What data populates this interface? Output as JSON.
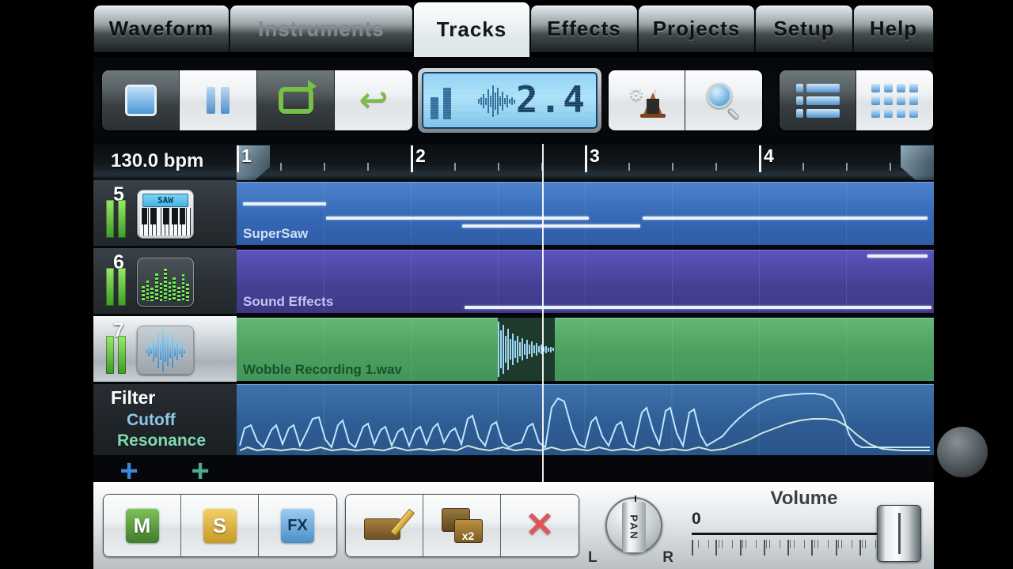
{
  "tabs": [
    {
      "label": "Waveform",
      "state": "normal"
    },
    {
      "label": "Instruments",
      "state": "dim"
    },
    {
      "label": "Tracks",
      "state": "active"
    },
    {
      "label": "Effects",
      "state": "normal"
    },
    {
      "label": "Projects",
      "state": "normal"
    },
    {
      "label": "Setup",
      "state": "normal"
    },
    {
      "label": "Help",
      "state": "normal"
    }
  ],
  "transport": {
    "stop_label": "Stop",
    "pause_label": "Pause",
    "loop_label": "Loop",
    "undo_label": "Undo",
    "undo_glyph": "↩",
    "metronome_label": "Metronome Settings",
    "gear_glyph": "⚙",
    "zoom_label": "Zoom",
    "list_view_label": "List View",
    "grid_view_label": "Grid View",
    "display_value": "2.4"
  },
  "timeline": {
    "bpm": "130.0 bpm",
    "bars": [
      "1",
      "2",
      "3",
      "4"
    ],
    "playhead_position": "2.4"
  },
  "tracks": [
    {
      "number": "5",
      "icon": "keyboard-icon",
      "icon_screen": "SAW",
      "clip_name": "SuperSaw",
      "clip_color": "#3a6fc4",
      "selected": false
    },
    {
      "number": "6",
      "icon": "equalizer-icon",
      "icon_screen": "",
      "clip_name": "Sound Effects",
      "clip_color": "#4a46a8",
      "selected": false
    },
    {
      "number": "7",
      "icon": "waveform-icon",
      "icon_screen": "",
      "clip_name": "Wobble Recording 1.wav",
      "clip_color": "#4faa63",
      "selected": true
    }
  ],
  "automation": {
    "title": "Filter",
    "param_cutoff": "Cutoff",
    "param_resonance": "Resonance",
    "cutoff_color": "#8fc7e8",
    "resonance_color": "#7fd8b0"
  },
  "add_buttons": {
    "add_midi_track": "+",
    "add_audio_track": "+"
  },
  "bottom_bar": {
    "mute_label": "M",
    "solo_label": "S",
    "fx_label": "FX",
    "edit_label": "Edit",
    "duplicate_label": "x2",
    "delete_label": "✕",
    "pan_label": "PAN",
    "pan_left": "L",
    "pan_right": "R",
    "volume_label": "Volume",
    "volume_value": "0"
  },
  "chart_data": {
    "type": "line",
    "title": "Filter automation",
    "series": [
      {
        "name": "Cutoff",
        "color": "#bfe6ff"
      },
      {
        "name": "Resonance",
        "color": "#cfe9d6"
      }
    ]
  }
}
